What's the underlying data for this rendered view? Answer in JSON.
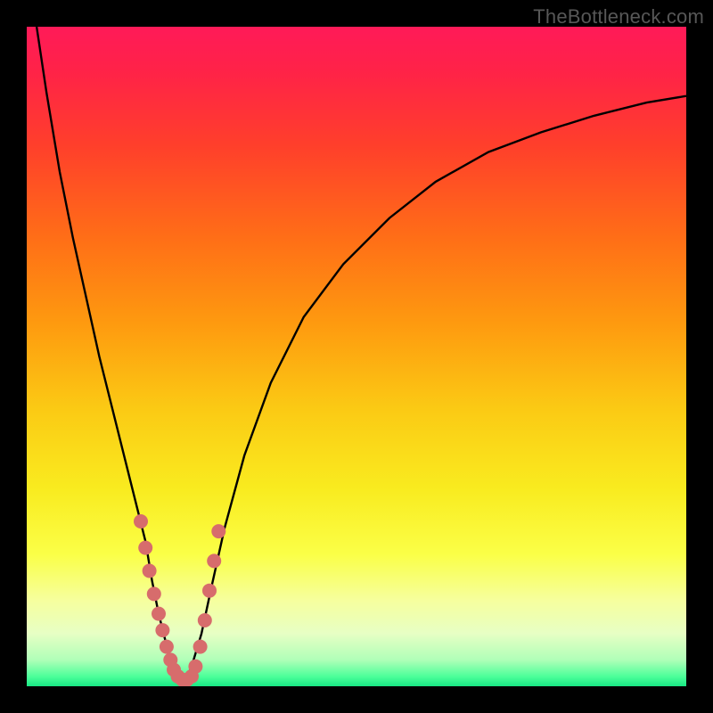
{
  "watermark": "TheBottleneck.com",
  "colors": {
    "frame": "#000000",
    "gradient_stops": [
      {
        "offset": 0.0,
        "color": "#ff1a58"
      },
      {
        "offset": 0.07,
        "color": "#ff2347"
      },
      {
        "offset": 0.18,
        "color": "#ff3f2b"
      },
      {
        "offset": 0.32,
        "color": "#ff6e17"
      },
      {
        "offset": 0.45,
        "color": "#fe9a0f"
      },
      {
        "offset": 0.58,
        "color": "#fbca14"
      },
      {
        "offset": 0.7,
        "color": "#f9eb1f"
      },
      {
        "offset": 0.8,
        "color": "#faff47"
      },
      {
        "offset": 0.87,
        "color": "#f6ff9e"
      },
      {
        "offset": 0.92,
        "color": "#e7ffc4"
      },
      {
        "offset": 0.96,
        "color": "#b0ffb8"
      },
      {
        "offset": 0.985,
        "color": "#4dff9a"
      },
      {
        "offset": 1.0,
        "color": "#18e884"
      }
    ],
    "curve": "#000000",
    "dot": "#d76c6c"
  },
  "chart_data": {
    "type": "line",
    "title": "",
    "xlabel": "",
    "ylabel": "",
    "xlim": [
      0,
      100
    ],
    "ylim": [
      0,
      100
    ],
    "grid": false,
    "legend": false,
    "series": [
      {
        "name": "left-branch",
        "x": [
          1.5,
          3,
          5,
          7,
          9,
          11,
          13,
          15,
          16.5,
          18,
          19,
          20,
          21,
          22,
          23
        ],
        "y": [
          100,
          90,
          78,
          68,
          59,
          50,
          42,
          34,
          28,
          22,
          16,
          11,
          7,
          3.5,
          0.8
        ]
      },
      {
        "name": "right-branch",
        "x": [
          24,
          25,
          26.5,
          28,
          30,
          33,
          37,
          42,
          48,
          55,
          62,
          70,
          78,
          86,
          94,
          100
        ],
        "y": [
          0.8,
          3,
          8,
          15,
          24,
          35,
          46,
          56,
          64,
          71,
          76.5,
          81,
          84,
          86.5,
          88.5,
          89.5
        ]
      }
    ],
    "dots": {
      "name": "highlight-dots",
      "x": [
        17.3,
        18.0,
        18.6,
        19.3,
        20.0,
        20.6,
        21.2,
        21.8,
        22.3,
        22.9,
        23.6,
        24.3,
        25.0,
        25.6,
        26.3,
        27.0,
        27.7,
        28.4,
        29.1
      ],
      "y": [
        25.0,
        21.0,
        17.5,
        14.0,
        11.0,
        8.5,
        6.0,
        4.0,
        2.5,
        1.5,
        1.0,
        1.0,
        1.5,
        3.0,
        6.0,
        10.0,
        14.5,
        19.0,
        23.5
      ]
    }
  }
}
